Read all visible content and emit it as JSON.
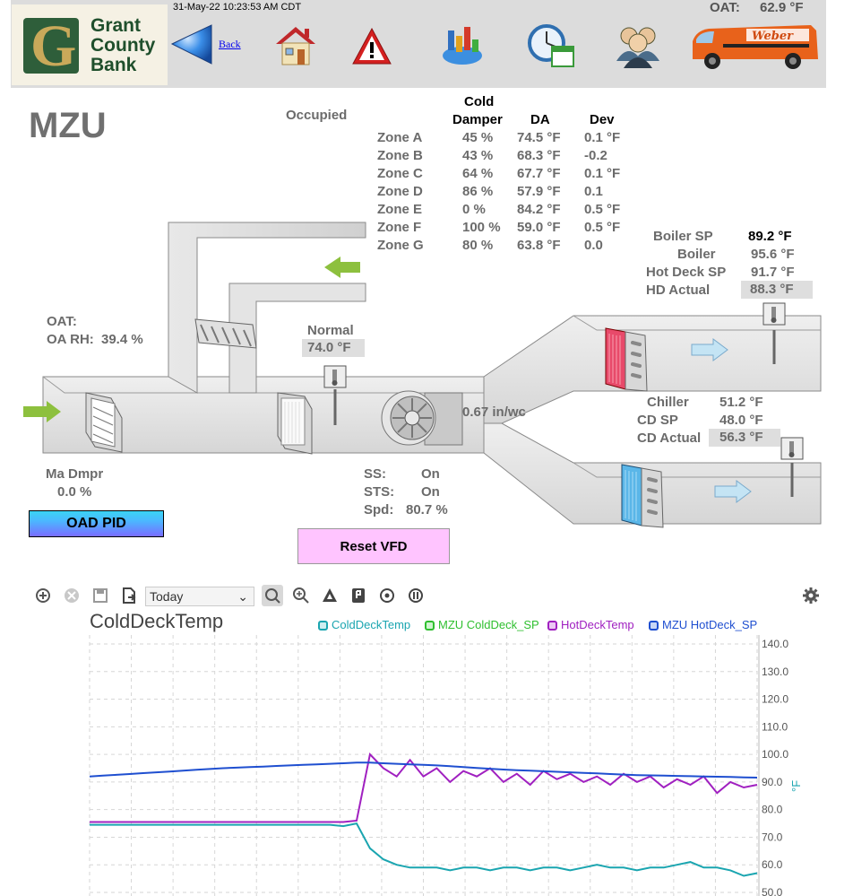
{
  "header": {
    "bank_name_1": "Grant",
    "bank_name_2": "County",
    "bank_name_3": "Bank",
    "timestamp": "31-May-22 10:23:53 AM CDT",
    "back_label": "Back",
    "oat_label": "OAT:",
    "oat_value": "62.9 °F",
    "van_brand": "Weber",
    "icons": [
      "back-arrow-icon",
      "home-icon",
      "alarm-warning-icon",
      "reports-chart-icon",
      "schedule-clock-icon",
      "users-icon",
      "service-van-logo"
    ]
  },
  "main": {
    "title": "MZU",
    "occupancy": "Occupied",
    "oat_label": "OAT:",
    "oa_rh_label": "OA RH:",
    "oa_rh_value": "39.4 %",
    "mode": "Normal",
    "mode_temp": "74.0 °F",
    "static_pressure": "0.67 in/wc",
    "ma_dmpr_label": "Ma Dmpr",
    "ma_dmpr_value": "0.0 %",
    "oad_pid_button": "OAD PID",
    "reset_vfd_button": "Reset VFD",
    "ss_label": "SS:",
    "ss_value": "On",
    "sts_label": "STS:",
    "sts_value": "On",
    "spd_label": "Spd:",
    "spd_value": "80.7 %"
  },
  "zones": {
    "header_cold_1": "Cold",
    "header_cold_2": "Damper",
    "header_da": "DA",
    "header_dev": "Dev",
    "rows": [
      {
        "zone": "Zone A",
        "damper": "45 %",
        "da": "74.5 °F",
        "dev": "0.1 °F"
      },
      {
        "zone": "Zone B",
        "damper": "43 %",
        "da": "68.3 °F",
        "dev": "-0.2"
      },
      {
        "zone": "Zone C",
        "damper": "64 %",
        "da": "67.7 °F",
        "dev": "0.1 °F"
      },
      {
        "zone": "Zone D",
        "damper": "86 %",
        "da": "57.9 °F",
        "dev": "0.1"
      },
      {
        "zone": "Zone E",
        "damper": "0 %",
        "da": "84.2 °F",
        "dev": "0.5 °F"
      },
      {
        "zone": "Zone F",
        "damper": "100 %",
        "da": "59.0 °F",
        "dev": "0.5 °F"
      },
      {
        "zone": "Zone G",
        "damper": "80 %",
        "da": "63.8 °F",
        "dev": "0.0"
      }
    ]
  },
  "hot_deck": {
    "boiler_sp_label": "Boiler SP",
    "boiler_sp_value": "89.2 °F",
    "boiler_label": "Boiler",
    "boiler_value": "95.6 °F",
    "hot_deck_sp_label": "Hot Deck SP",
    "hot_deck_sp_value": "91.7 °F",
    "hd_actual_label": "HD Actual",
    "hd_actual_value": "88.3 °F"
  },
  "cold_deck": {
    "chiller_label": "Chiller",
    "chiller_value": "51.2 °F",
    "cd_sp_label": "CD SP",
    "cd_sp_value": "48.0 °F",
    "cd_actual_label": "CD Actual",
    "cd_actual_value": "56.3 °F"
  },
  "toolbar": {
    "range_selected": "Today",
    "icons": [
      "zoom-in-icon",
      "clear-icon",
      "save-icon",
      "export-icon",
      "range-select",
      "zoom-reset-icon",
      "magnify-icon",
      "triangle-icon",
      "bookmark-icon",
      "target-icon",
      "pause-icon",
      "settings-gear-icon"
    ]
  },
  "chart_data": {
    "type": "line",
    "title": "ColdDeckTemp",
    "ylabel": "°F",
    "ylim": [
      50,
      140
    ],
    "yticks": [
      "140.0",
      "130.0",
      "120.0",
      "110.0",
      "100.0",
      "90.0",
      "80.0",
      "70.0",
      "60.0",
      "50.0"
    ],
    "grid": true,
    "legend_position": "top",
    "series": [
      {
        "name": "ColdDeckTemp",
        "color": "#1aa5b0",
        "values": [
          74.5,
          74.5,
          74.5,
          74.5,
          74.5,
          74.5,
          74.5,
          74.5,
          74.5,
          74.5,
          74.5,
          74.5,
          74.5,
          74.5,
          74.5,
          74.5,
          74.5,
          74.5,
          74.5,
          74,
          75,
          66,
          62,
          60,
          59,
          59,
          59,
          58,
          59,
          59,
          58,
          59,
          59,
          58,
          59,
          59,
          58,
          59,
          60,
          59,
          59,
          58,
          59,
          59,
          60,
          61,
          59,
          59,
          58,
          56,
          57
        ]
      },
      {
        "name": "MZU ColdDeck_SP",
        "color": "#2fbf2f",
        "values": []
      },
      {
        "name": "HotDeckTemp",
        "color": "#a020c0",
        "values": [
          75.5,
          75.5,
          75.5,
          75.5,
          75.5,
          75.5,
          75.5,
          75.5,
          75.5,
          75.5,
          75.5,
          75.5,
          75.5,
          75.5,
          75.5,
          75.5,
          75.5,
          75.5,
          75.5,
          75.5,
          76,
          100,
          95,
          92,
          98,
          92,
          95,
          90,
          94,
          92,
          95,
          90,
          93,
          89,
          94,
          91,
          93,
          90,
          92,
          89,
          93,
          90,
          92,
          88,
          91,
          89,
          92,
          86,
          90,
          88,
          89
        ]
      },
      {
        "name": "MZU HotDeck_SP",
        "color": "#1f4fd0",
        "values": [
          92,
          92.3,
          92.6,
          92.9,
          93.2,
          93.5,
          93.8,
          94.1,
          94.4,
          94.7,
          95,
          95.2,
          95.4,
          95.6,
          95.8,
          96,
          96.2,
          96.4,
          96.6,
          96.8,
          97,
          97,
          96.8,
          96.6,
          96.4,
          96.2,
          96,
          95.7,
          95.4,
          95.1,
          94.8,
          94.5,
          94.3,
          94.1,
          93.9,
          93.7,
          93.5,
          93.3,
          93.1,
          92.9,
          92.7,
          92.5,
          92.4,
          92.3,
          92.2,
          92.1,
          92,
          91.9,
          91.8,
          91.7,
          91.6
        ]
      }
    ]
  }
}
